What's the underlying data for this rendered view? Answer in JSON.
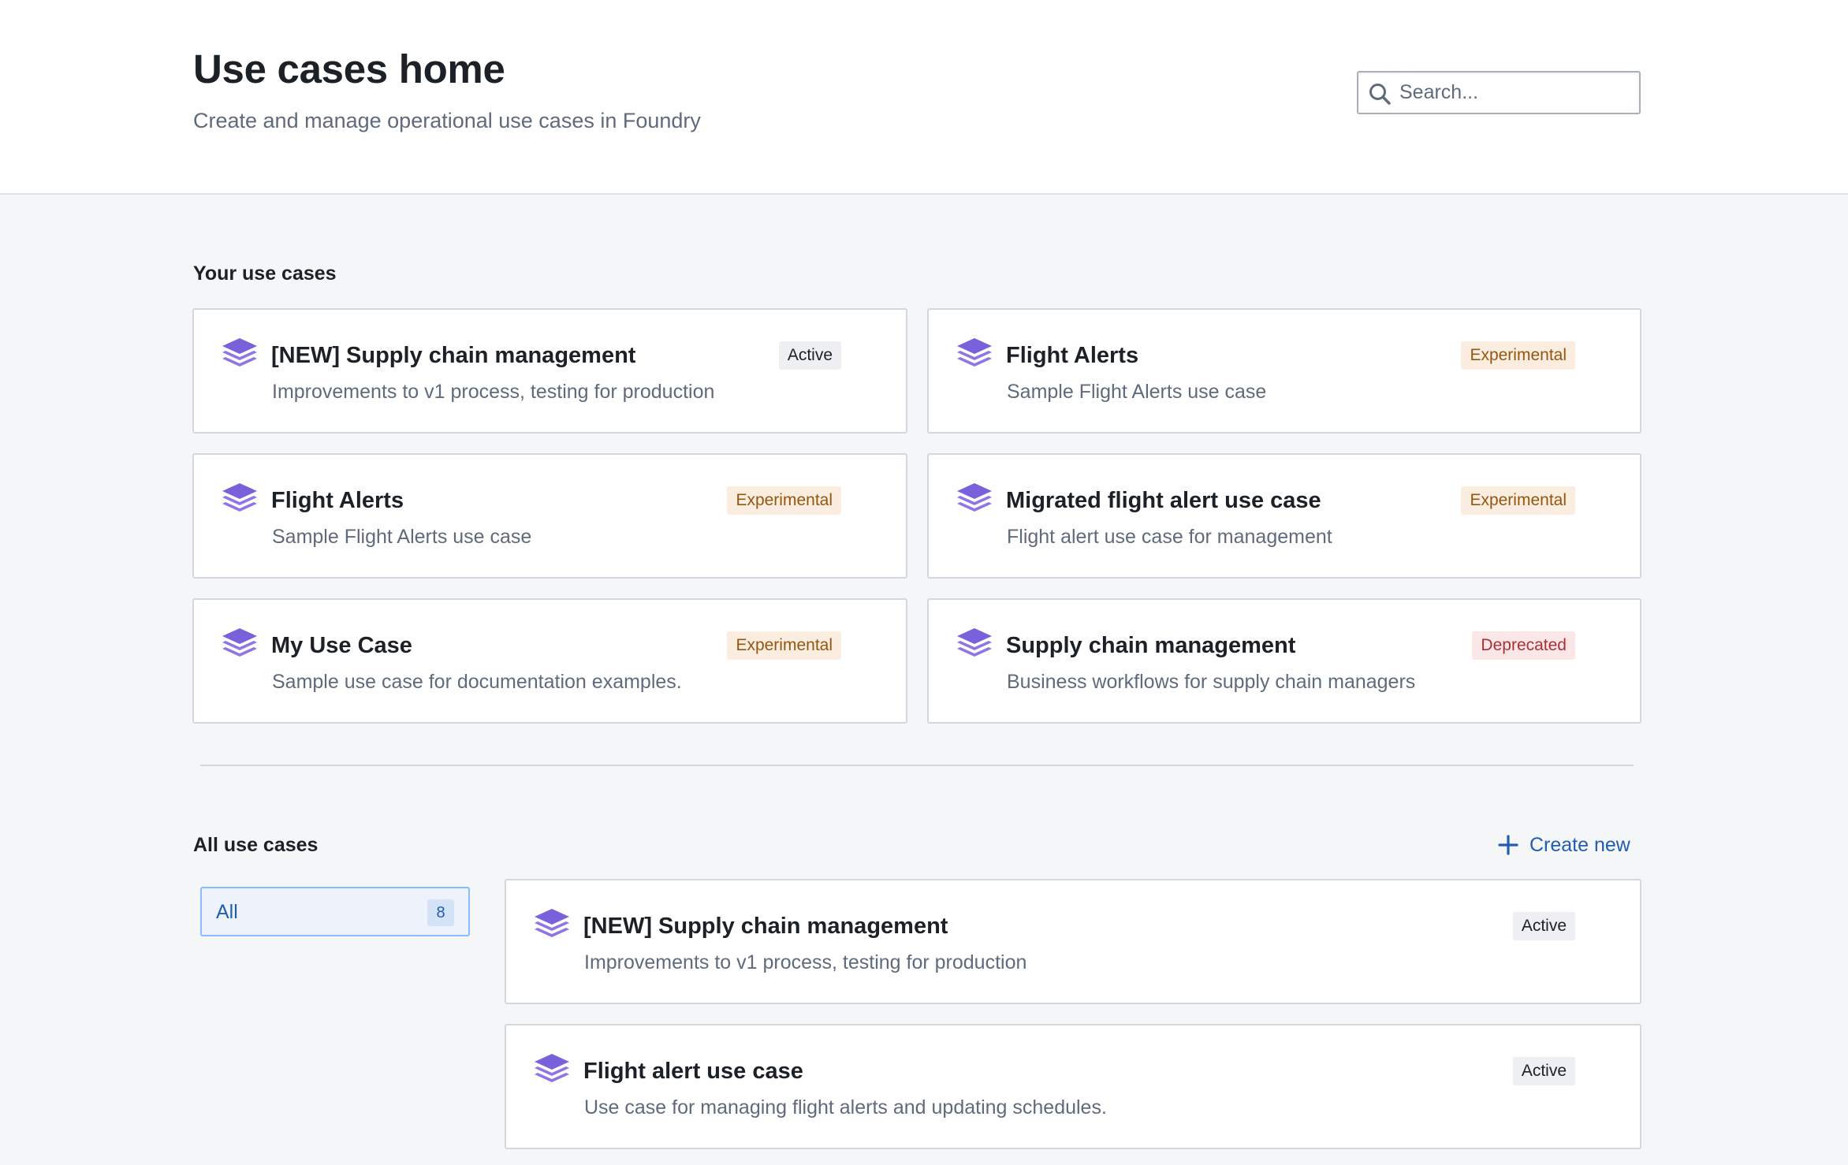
{
  "header": {
    "title": "Use cases home",
    "subtitle": "Create and manage operational use cases in Foundry",
    "search_placeholder": "Search..."
  },
  "your_use_cases": {
    "title": "Your use cases",
    "cards": [
      {
        "title": "[NEW] Supply chain management",
        "description": "Improvements to v1 process, testing for production",
        "status": "Active"
      },
      {
        "title": "Flight Alerts",
        "description": "Sample Flight Alerts use case",
        "status": "Experimental"
      },
      {
        "title": "Flight Alerts",
        "description": "Sample Flight Alerts use case",
        "status": "Experimental"
      },
      {
        "title": "Migrated flight alert use case",
        "description": "Flight alert use case for management",
        "status": "Experimental"
      },
      {
        "title": "My Use Case",
        "description": "Sample use case for documentation examples.",
        "status": "Experimental"
      },
      {
        "title": "Supply chain management",
        "description": "Business workflows for supply chain managers",
        "status": "Deprecated"
      }
    ]
  },
  "all_use_cases": {
    "title": "All use cases",
    "create_label": "Create new",
    "filter": {
      "label": "All",
      "count": "8"
    },
    "items": [
      {
        "title": "[NEW] Supply chain management",
        "description": "Improvements to v1 process, testing for production",
        "status": "Active"
      },
      {
        "title": "Flight alert use case",
        "description": "Use case for managing flight alerts and updating schedules.",
        "status": "Active"
      }
    ]
  },
  "colors": {
    "accent_blue": "#215db0",
    "icon_purple": "#7961db",
    "experimental": "#935610",
    "deprecated": "#ac2f33"
  },
  "icons": {
    "use_case": "layers-icon",
    "search": "search-icon",
    "create": "plus-icon"
  }
}
